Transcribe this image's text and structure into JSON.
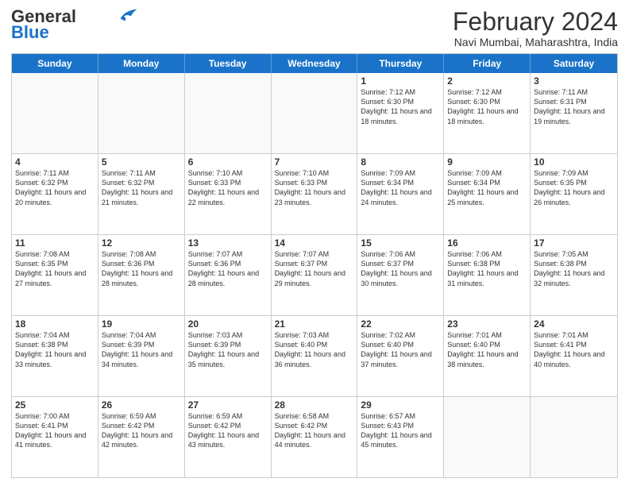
{
  "logo": {
    "text_general": "General",
    "text_blue": "Blue"
  },
  "title": {
    "month_year": "February 2024",
    "location": "Navi Mumbai, Maharashtra, India"
  },
  "calendar": {
    "headers": [
      "Sunday",
      "Monday",
      "Tuesday",
      "Wednesday",
      "Thursday",
      "Friday",
      "Saturday"
    ],
    "rows": [
      [
        {
          "day": "",
          "info": ""
        },
        {
          "day": "",
          "info": ""
        },
        {
          "day": "",
          "info": ""
        },
        {
          "day": "",
          "info": ""
        },
        {
          "day": "1",
          "info": "Sunrise: 7:12 AM\nSunset: 6:30 PM\nDaylight: 11 hours and 18 minutes."
        },
        {
          "day": "2",
          "info": "Sunrise: 7:12 AM\nSunset: 6:30 PM\nDaylight: 11 hours and 18 minutes."
        },
        {
          "day": "3",
          "info": "Sunrise: 7:11 AM\nSunset: 6:31 PM\nDaylight: 11 hours and 19 minutes."
        }
      ],
      [
        {
          "day": "4",
          "info": "Sunrise: 7:11 AM\nSunset: 6:32 PM\nDaylight: 11 hours and 20 minutes."
        },
        {
          "day": "5",
          "info": "Sunrise: 7:11 AM\nSunset: 6:32 PM\nDaylight: 11 hours and 21 minutes."
        },
        {
          "day": "6",
          "info": "Sunrise: 7:10 AM\nSunset: 6:33 PM\nDaylight: 11 hours and 22 minutes."
        },
        {
          "day": "7",
          "info": "Sunrise: 7:10 AM\nSunset: 6:33 PM\nDaylight: 11 hours and 23 minutes."
        },
        {
          "day": "8",
          "info": "Sunrise: 7:09 AM\nSunset: 6:34 PM\nDaylight: 11 hours and 24 minutes."
        },
        {
          "day": "9",
          "info": "Sunrise: 7:09 AM\nSunset: 6:34 PM\nDaylight: 11 hours and 25 minutes."
        },
        {
          "day": "10",
          "info": "Sunrise: 7:09 AM\nSunset: 6:35 PM\nDaylight: 11 hours and 26 minutes."
        }
      ],
      [
        {
          "day": "11",
          "info": "Sunrise: 7:08 AM\nSunset: 6:35 PM\nDaylight: 11 hours and 27 minutes."
        },
        {
          "day": "12",
          "info": "Sunrise: 7:08 AM\nSunset: 6:36 PM\nDaylight: 11 hours and 28 minutes."
        },
        {
          "day": "13",
          "info": "Sunrise: 7:07 AM\nSunset: 6:36 PM\nDaylight: 11 hours and 28 minutes."
        },
        {
          "day": "14",
          "info": "Sunrise: 7:07 AM\nSunset: 6:37 PM\nDaylight: 11 hours and 29 minutes."
        },
        {
          "day": "15",
          "info": "Sunrise: 7:06 AM\nSunset: 6:37 PM\nDaylight: 11 hours and 30 minutes."
        },
        {
          "day": "16",
          "info": "Sunrise: 7:06 AM\nSunset: 6:38 PM\nDaylight: 11 hours and 31 minutes."
        },
        {
          "day": "17",
          "info": "Sunrise: 7:05 AM\nSunset: 6:38 PM\nDaylight: 11 hours and 32 minutes."
        }
      ],
      [
        {
          "day": "18",
          "info": "Sunrise: 7:04 AM\nSunset: 6:38 PM\nDaylight: 11 hours and 33 minutes."
        },
        {
          "day": "19",
          "info": "Sunrise: 7:04 AM\nSunset: 6:39 PM\nDaylight: 11 hours and 34 minutes."
        },
        {
          "day": "20",
          "info": "Sunrise: 7:03 AM\nSunset: 6:39 PM\nDaylight: 11 hours and 35 minutes."
        },
        {
          "day": "21",
          "info": "Sunrise: 7:03 AM\nSunset: 6:40 PM\nDaylight: 11 hours and 36 minutes."
        },
        {
          "day": "22",
          "info": "Sunrise: 7:02 AM\nSunset: 6:40 PM\nDaylight: 11 hours and 37 minutes."
        },
        {
          "day": "23",
          "info": "Sunrise: 7:01 AM\nSunset: 6:40 PM\nDaylight: 11 hours and 38 minutes."
        },
        {
          "day": "24",
          "info": "Sunrise: 7:01 AM\nSunset: 6:41 PM\nDaylight: 11 hours and 40 minutes."
        }
      ],
      [
        {
          "day": "25",
          "info": "Sunrise: 7:00 AM\nSunset: 6:41 PM\nDaylight: 11 hours and 41 minutes."
        },
        {
          "day": "26",
          "info": "Sunrise: 6:59 AM\nSunset: 6:42 PM\nDaylight: 11 hours and 42 minutes."
        },
        {
          "day": "27",
          "info": "Sunrise: 6:59 AM\nSunset: 6:42 PM\nDaylight: 11 hours and 43 minutes."
        },
        {
          "day": "28",
          "info": "Sunrise: 6:58 AM\nSunset: 6:42 PM\nDaylight: 11 hours and 44 minutes."
        },
        {
          "day": "29",
          "info": "Sunrise: 6:57 AM\nSunset: 6:43 PM\nDaylight: 11 hours and 45 minutes."
        },
        {
          "day": "",
          "info": ""
        },
        {
          "day": "",
          "info": ""
        }
      ]
    ]
  }
}
